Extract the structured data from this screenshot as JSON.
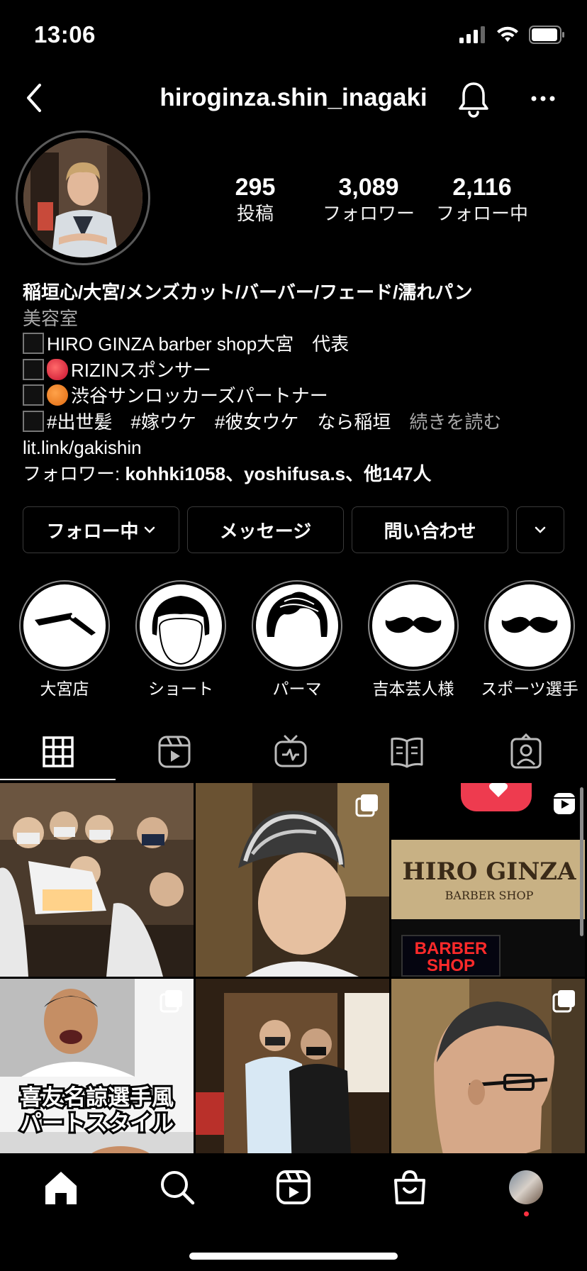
{
  "status": {
    "time": "13:06"
  },
  "header": {
    "username": "hiroginza.shin_inagaki"
  },
  "stats": [
    {
      "number": "295",
      "label": "投稿"
    },
    {
      "number": "3,089",
      "label": "フォロワー"
    },
    {
      "number": "2,116",
      "label": "フォロー中"
    }
  ],
  "bio": {
    "name": "稲垣心/大宮/メンズカット/バーバー/フェード/濡れパン",
    "category": "美容室",
    "lines": [
      "HIRO GINZA barber shop大宮　代表",
      "RIZINスポンサー",
      "渋谷サンロッカーズパートナー",
      "#出世髪　#嫁ウケ　#彼女ウケ　なら稲垣"
    ],
    "more": "続きを読む",
    "link": "lit.link/gakishin",
    "followed_by_prefix": "フォロワー: ",
    "followed_by_names": "kohhki1058、yoshifusa.s、他147人"
  },
  "buttons": {
    "following": "フォロー中",
    "message": "メッセージ",
    "contact": "問い合わせ"
  },
  "highlights": [
    {
      "label": "大宮店",
      "icon": "razor-icon"
    },
    {
      "label": "ショート",
      "icon": "short-hair-icon"
    },
    {
      "label": "パーマ",
      "icon": "perm-hair-icon"
    },
    {
      "label": "吉本芸人様",
      "icon": "mustache-icon"
    },
    {
      "label": "スポーツ選手",
      "icon": "mustache-icon"
    }
  ],
  "tabs": [
    "grid-icon",
    "reels-icon",
    "igtv-icon",
    "guides-icon",
    "tagged-icon"
  ],
  "posts": {
    "p3_sign_title": "HIRO GINZA",
    "p3_sign_sub": "BARBER SHOP",
    "p3_neon": "BARBER SHOP",
    "p4_caption_1": "喜友名諒選手風",
    "p4_caption_2": "パートスタイル"
  },
  "colors": {
    "background": "#000000",
    "text": "#ffffff",
    "muted": "#a8a8a8",
    "border": "#3a3a3a",
    "notify_dot": "#ff3040"
  }
}
